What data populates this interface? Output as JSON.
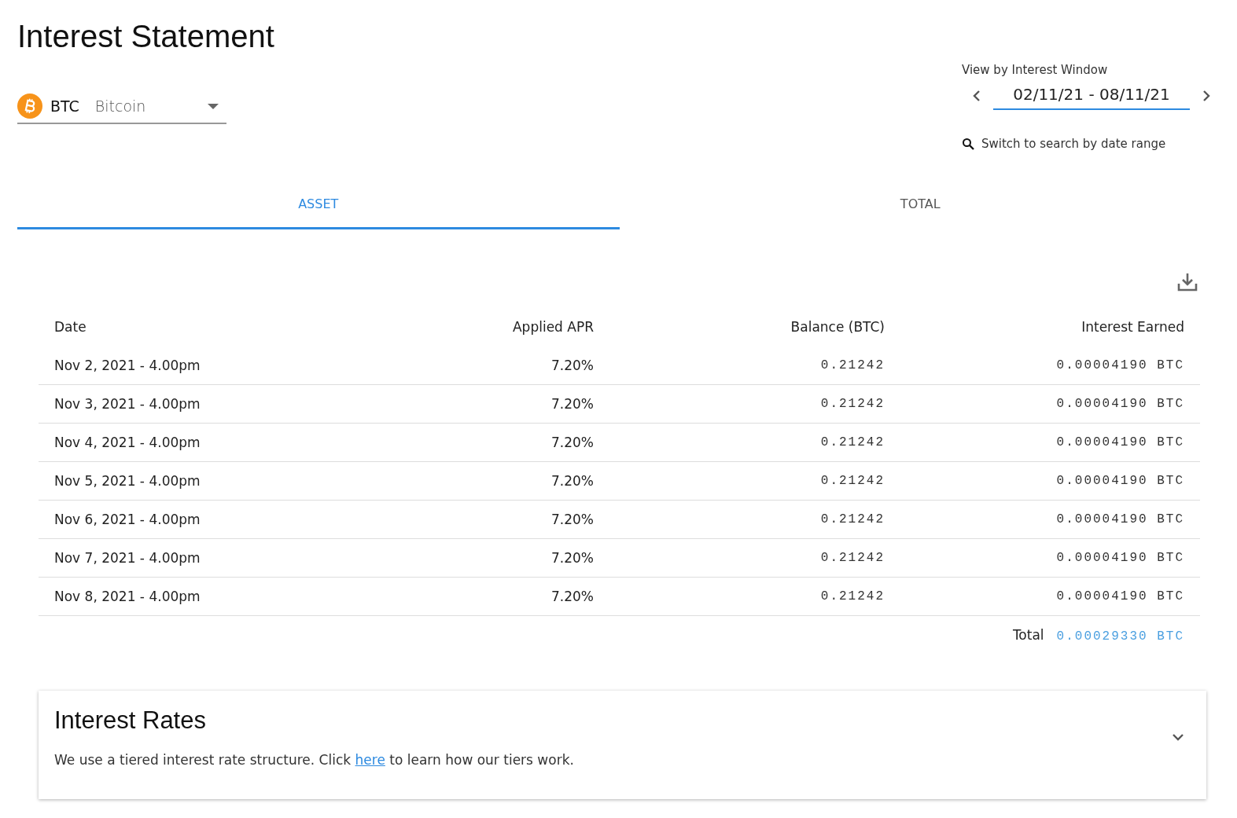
{
  "title": "Interest Statement",
  "asset_select": {
    "symbol": "BTC",
    "name": "Bitcoin"
  },
  "interest_window": {
    "label": "View by Interest Window",
    "value": "02/11/21 - 08/11/21",
    "switch_link": "Switch to search by date range"
  },
  "tabs": [
    {
      "label": "ASSET",
      "selected": true
    },
    {
      "label": "TOTAL",
      "selected": false
    }
  ],
  "table": {
    "columns": [
      "Date",
      "Applied APR",
      "Balance (BTC)",
      "Interest Earned"
    ],
    "rows": [
      [
        "Nov 2, 2021 - 4.00pm",
        "7.20%",
        "0.21242",
        "0.00004190 BTC"
      ],
      [
        "Nov 3, 2021 - 4.00pm",
        "7.20%",
        "0.21242",
        "0.00004190 BTC"
      ],
      [
        "Nov 4, 2021 - 4.00pm",
        "7.20%",
        "0.21242",
        "0.00004190 BTC"
      ],
      [
        "Nov 5, 2021 - 4.00pm",
        "7.20%",
        "0.21242",
        "0.00004190 BTC"
      ],
      [
        "Nov 6, 2021 - 4.00pm",
        "7.20%",
        "0.21242",
        "0.00004190 BTC"
      ],
      [
        "Nov 7, 2021 - 4.00pm",
        "7.20%",
        "0.21242",
        "0.00004190 BTC"
      ],
      [
        "Nov 8, 2021 - 4.00pm",
        "7.20%",
        "0.21242",
        "0.00004190 BTC"
      ]
    ],
    "total_label": "Total",
    "total_value": "0.00029330 BTC"
  },
  "interest_rates": {
    "title": "Interest Rates",
    "expanded": false,
    "text_before": "We use a tiered interest rate structure. Click ",
    "link": "here",
    "text_after": " to learn how our tiers work."
  }
}
